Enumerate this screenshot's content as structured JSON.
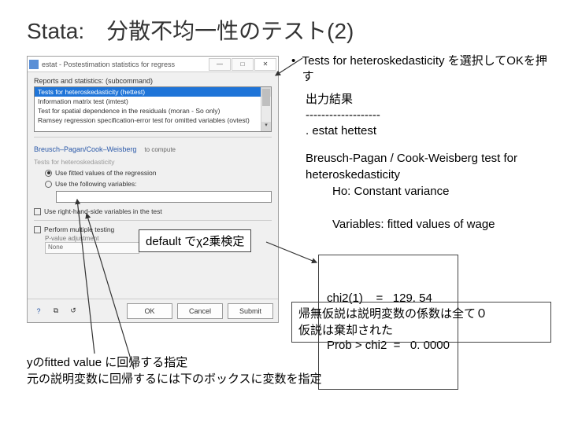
{
  "slide": {
    "title": "Stata:　分散不均一性のテスト(2)"
  },
  "dialog": {
    "titlebar": "estat - Postestimation statistics for regress",
    "subcommand_label": "Reports and statistics: (subcommand)",
    "list": {
      "item1": "Tests for heteroskedasticity (hettest)",
      "item2": "Information matrix test (imtest)",
      "item3": "Test for spatial dependence in the residuals (moran - So only)",
      "item4": "Ramsey regression specification-error test for omitted variables (ovtest)"
    },
    "group_header": "Breusch–Pagan/Cook–Weisberg",
    "group_hint": "to compute",
    "radio1_main": "Tests for heteroskedasticity",
    "radio1_sub": "Use fitted values of the regression",
    "radio2": "Use the following variables:",
    "chk_rhs": "Use right-hand-side variables in the test",
    "chk_mtest": "Perform multiple testing",
    "pvalue_label": "P-value adjustment",
    "pvalue_value": "None",
    "buttons": {
      "ok": "OK",
      "cancel": "Cancel",
      "submit": "Submit"
    }
  },
  "right": {
    "bullet_text": "Tests for heteroskedasticity を選択してOKを押す",
    "output_label": "出力結果",
    "dashes": "-------------------",
    "cmd": ". estat hettest",
    "test_line1": "Breusch-Pagan / Cook-Weisberg test for heteroskedasticity",
    "test_ho": "Ho: Constant variance",
    "test_vars": "Variables: fitted values of wage",
    "chi_line": "chi2(1)    =   129. 54",
    "prob_line": "Prob > chi2  =   0. 0000"
  },
  "annotations": {
    "chi_callout": "default でχ2乗検定",
    "conclusion_line1": "帰無仮説は説明変数の係数は全て０",
    "conclusion_line2": "仮説は棄却された",
    "foot_line1": "yのfitted value に回帰する指定",
    "foot_line2": "元の説明変数に回帰するには下のボックスに変数を指定"
  }
}
